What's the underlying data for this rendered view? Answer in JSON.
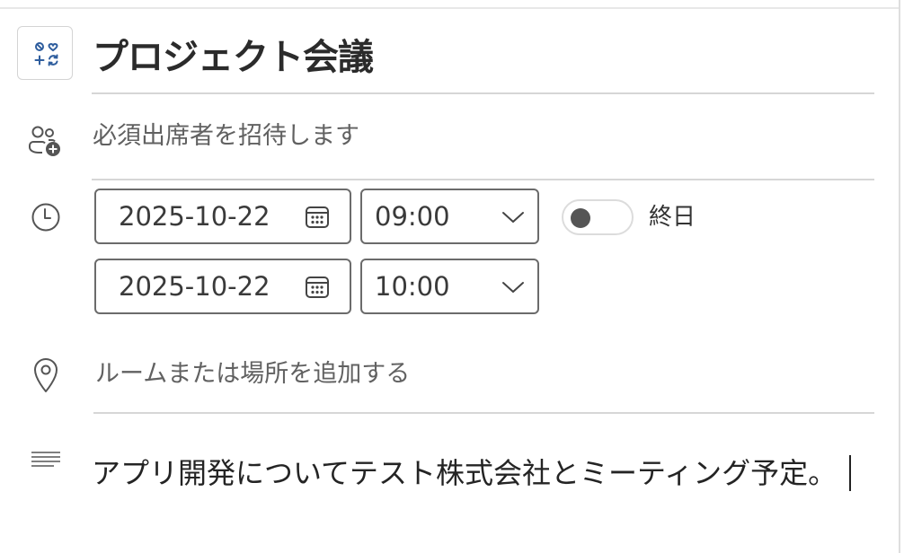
{
  "event": {
    "title": "プロジェクト会議",
    "category_icon": "category-icon"
  },
  "attendees": {
    "placeholder": "必須出席者を招待します",
    "icon": "people-add-icon"
  },
  "schedule": {
    "icon": "clock-icon",
    "start_date": "2025-10-22",
    "start_time": "09:00",
    "end_date": "2025-10-22",
    "end_time": "10:00",
    "all_day_label": "終日",
    "all_day_enabled": false,
    "calendar_icon": "calendar-icon",
    "dropdown_icon": "chevron-down-icon"
  },
  "location": {
    "placeholder": "ルームまたは場所を追加する",
    "icon": "location-pin-icon"
  },
  "body": {
    "icon": "text-lines-icon",
    "text": "アプリ開発についてテスト株式会社とミーティング予定。"
  },
  "colors": {
    "border": "#6b6b6b",
    "divider": "#d6d6d6",
    "placeholder": "#616161",
    "text": "#242424",
    "icon_accent": "#2f5e9e"
  }
}
